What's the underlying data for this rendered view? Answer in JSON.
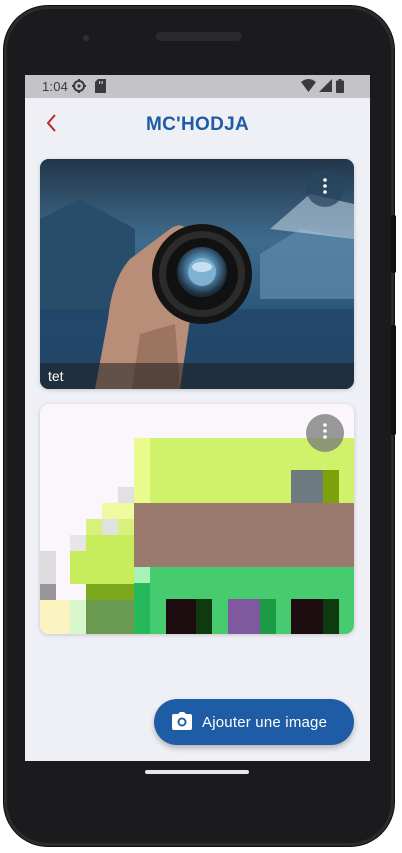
{
  "status_bar": {
    "time": "1:04",
    "icons": [
      "settings-gear-icon",
      "sd-card-icon",
      "wifi-icon",
      "cellular-signal-icon",
      "battery-icon"
    ]
  },
  "app_bar": {
    "title": "MC'HODJA",
    "back_icon": "chevron-left-icon"
  },
  "gallery": {
    "items": [
      {
        "caption": "tet",
        "image": "hand holding camera lens over lake and mountains",
        "menu_icon": "more-vertical-icon"
      },
      {
        "caption": "",
        "image": "pixelated green and pink abstract image",
        "menu_icon": "more-vertical-icon"
      }
    ]
  },
  "fab": {
    "label": "Ajouter une image",
    "icon": "camera-icon"
  },
  "colors": {
    "accent": "#1e5da6",
    "back_arrow": "#b22b2b",
    "background": "#eef0f5",
    "status_bar": "#c4c4c8"
  }
}
